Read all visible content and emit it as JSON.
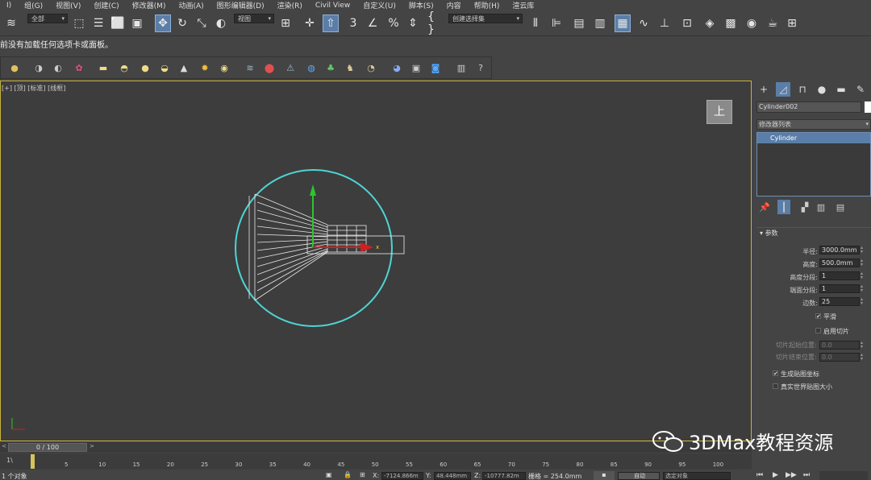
{
  "menu": [
    "I)",
    "组(G)",
    "视图(V)",
    "创建(C)",
    "修改器(M)",
    "动画(A)",
    "图形编辑器(D)",
    "渲染(R)",
    "Civil View",
    "自定义(U)",
    "脚本(S)",
    "内容",
    "帮助(H)",
    "渲云库"
  ],
  "toolbar": {
    "selection_filter": "全部",
    "coord_system": "视图",
    "named_selection": "创建选择集"
  },
  "prompt": "前没有加载任何选项卡或面板。",
  "viewport": {
    "label_plus": "[+]",
    "label_view": "[顶]",
    "label_shading": "[标准]",
    "label_mode": "[线框]",
    "viewcube_label": "上",
    "axis_x": "x"
  },
  "command_panel": {
    "object_name": "Cylinder002",
    "modifier_list": "修改器列表",
    "stack_item": "Cylinder",
    "rollout_title": "参数",
    "params": [
      {
        "label": "半径:",
        "value": "3000.0mm"
      },
      {
        "label": "高度:",
        "value": "500.0mm"
      },
      {
        "label": "高度分段:",
        "value": "1"
      },
      {
        "label": "端面分段:",
        "value": "1"
      },
      {
        "label": "边数:",
        "value": "25"
      }
    ],
    "smooth_label": "平滑",
    "slice_on_label": "启用切片",
    "slice_from_label": "切片起始位置:",
    "slice_from_value": "0.0",
    "slice_to_label": "切片结束位置:",
    "slice_to_value": "0.0",
    "gen_uv_label": "生成贴图坐标",
    "real_world_label": "真实世界贴图大小",
    "smooth_checked": "✔",
    "gen_uv_checked": "✔"
  },
  "timeline": {
    "position": "0 / 100",
    "ticks": [
      "5",
      "10",
      "15",
      "20",
      "25",
      "30",
      "35",
      "40",
      "45",
      "50",
      "55",
      "60",
      "65",
      "70",
      "75",
      "80",
      "85",
      "90",
      "95",
      "100"
    ],
    "prompt_btn": "1\\"
  },
  "statusbar": {
    "selected": "1 个对象",
    "x_label": "X:",
    "x_value": "-7124.866m",
    "y_label": "Y:",
    "y_value": "48.448mm",
    "z_label": "Z:",
    "z_value": "-10777.82m",
    "grid": "栅格 = 254.0mm",
    "auto_key": "自动",
    "selected_obj": "选定对象"
  },
  "watermark": "3DMax教程资源",
  "colors": {
    "accent": "#5a7ea8",
    "viewport_border": "#c8b43a",
    "cylinder": "#4fd4d4"
  }
}
